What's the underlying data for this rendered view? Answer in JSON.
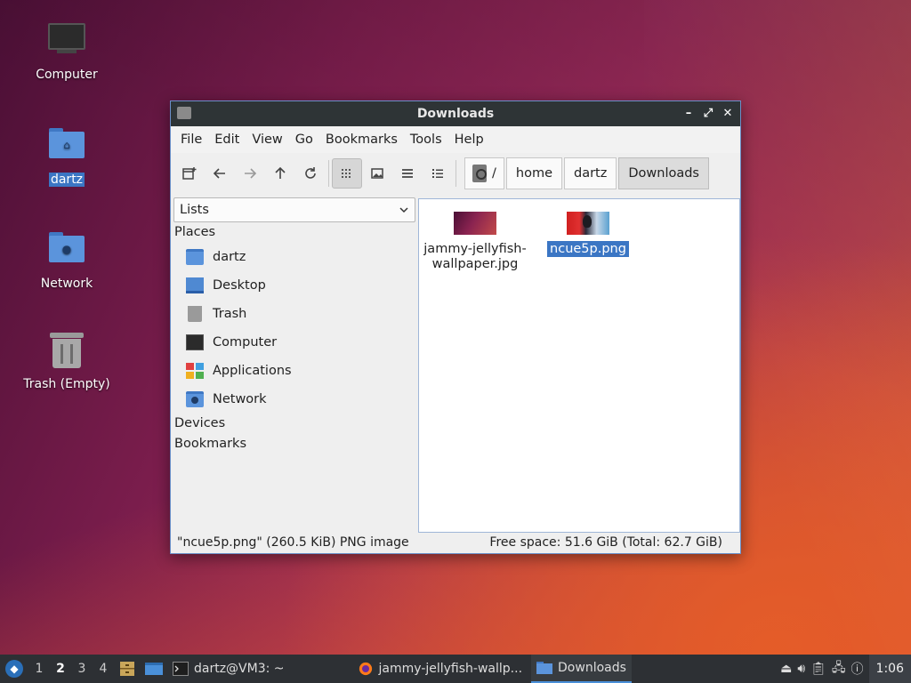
{
  "desktop": {
    "icons": [
      {
        "label": "Computer",
        "icon": "computer-icon"
      },
      {
        "label": "dartz",
        "icon": "home-folder-icon"
      },
      {
        "label": "Network",
        "icon": "network-folder-icon"
      },
      {
        "label": "Trash (Empty)",
        "icon": "trash-icon"
      }
    ]
  },
  "window": {
    "title": "Downloads",
    "controls": {
      "minimize": "–",
      "maximize": "⤢",
      "close": "✕"
    },
    "menu": [
      "File",
      "Edit",
      "View",
      "Go",
      "Bookmarks",
      "Tools",
      "Help"
    ],
    "toolbar": {
      "icons": [
        "new-tab-icon",
        "back-icon",
        "forward-icon",
        "up-icon",
        "reload-icon",
        "icon-view-icon",
        "thumbnail-view-icon",
        "compact-view-icon",
        "detailed-list-view-icon"
      ]
    },
    "path": {
      "root": "/",
      "crumbs": [
        "home",
        "dartz",
        "Downloads"
      ]
    },
    "side": {
      "mode": "Lists",
      "places_heading": "Places",
      "places": [
        "dartz",
        "Desktop",
        "Trash",
        "Computer",
        "Applications",
        "Network"
      ],
      "devices_heading": "Devices",
      "bookmarks_heading": "Bookmarks"
    },
    "files": [
      {
        "name": "jammy-jellyfish-wallpaper.jpg",
        "line1": "jammy-jellyfish-",
        "line2": "wallpaper.jpg",
        "selected": false
      },
      {
        "name": "ncue5p.png",
        "line1": "ncue5p.png",
        "line2": "",
        "selected": true
      }
    ],
    "status": {
      "left": "\"ncue5p.png\" (260.5 KiB) PNG image",
      "right": "Free space: 51.6 GiB (Total: 62.7 GiB)"
    }
  },
  "taskbar": {
    "workspaces": [
      "1",
      "2",
      "3",
      "4"
    ],
    "active_workspace": "2",
    "tasks": [
      {
        "label": "dartz@VM3: ~",
        "icon": "terminal-icon"
      },
      {
        "label": "jammy-jellyfish-wallp...",
        "icon": "firefox-icon"
      },
      {
        "label": "Downloads",
        "icon": "folder-icon"
      }
    ],
    "clock": "1:06"
  },
  "colors": {
    "selection": "#3b76c4",
    "titlebar": "#2e3436",
    "taskbar": "#2d3034"
  }
}
